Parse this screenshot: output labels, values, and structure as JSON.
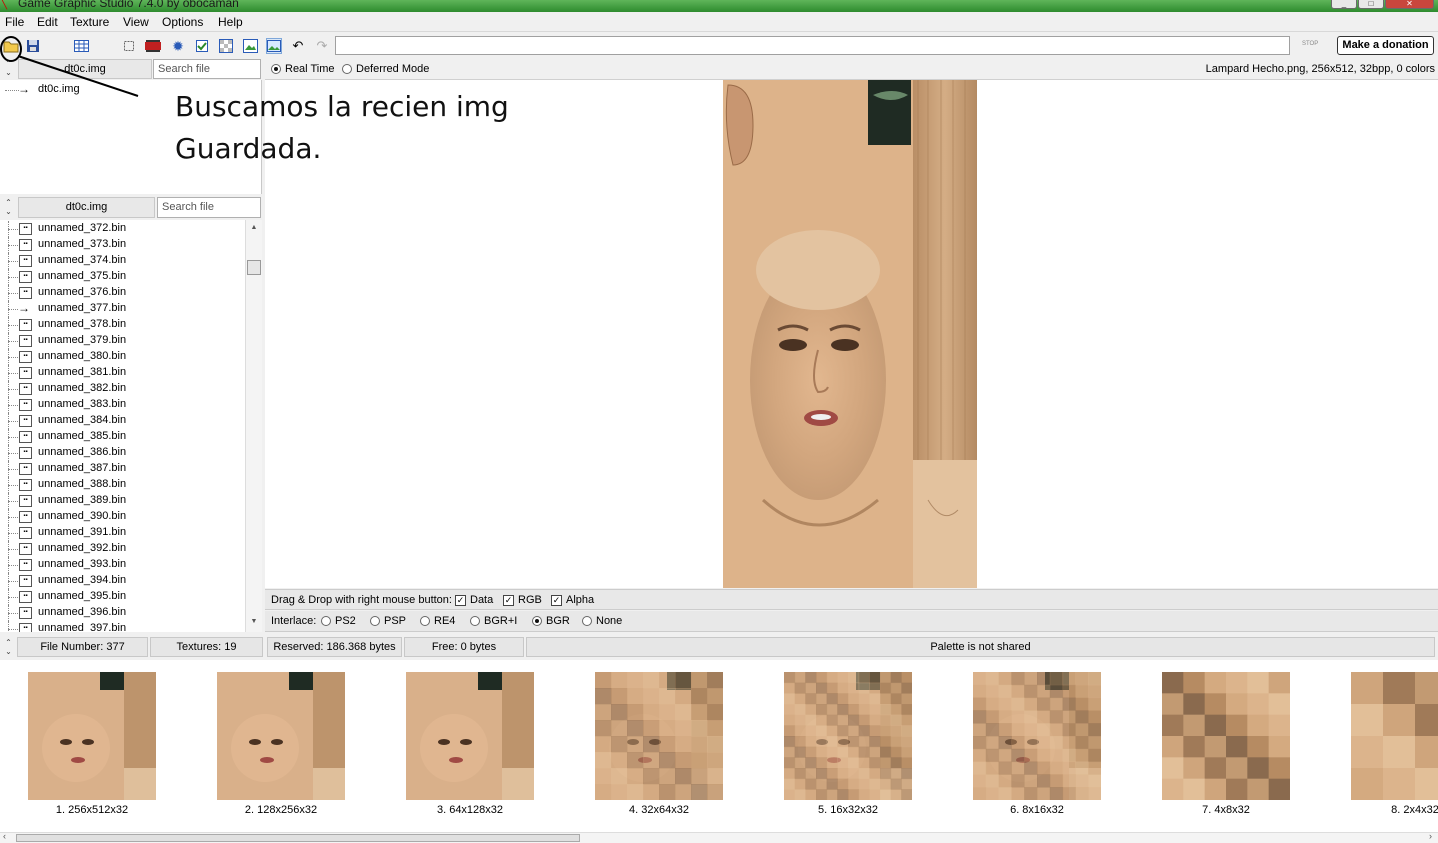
{
  "window": {
    "title": "Game Graphic Studio 7.4.0 by obocaman",
    "buttons": [
      "_",
      "□",
      "✕"
    ]
  },
  "menu": [
    "File",
    "Edit",
    "Texture",
    "View",
    "Options",
    "Help"
  ],
  "toolbar": {
    "stop_label": "STOP",
    "donate_label": "Make a donation",
    "icons": [
      "open-folder-icon",
      "save-icon",
      "grid-icon",
      "blank-icon",
      "film-icon",
      "gear-icon",
      "check-icon",
      "transparency-icon",
      "fit-image-icon",
      "image-icon",
      "undo-icon",
      "redo-icon"
    ]
  },
  "top_panel": {
    "header": "dt0c.img",
    "search_placeholder": "Search file",
    "tree_item": "dt0c.img"
  },
  "file_panel": {
    "header": "dt0c.img",
    "search_placeholder": "Search file",
    "files": [
      "unnamed_372.bin",
      "unnamed_373.bin",
      "unnamed_374.bin",
      "unnamed_375.bin",
      "unnamed_376.bin",
      "unnamed_377.bin",
      "unnamed_378.bin",
      "unnamed_379.bin",
      "unnamed_380.bin",
      "unnamed_381.bin",
      "unnamed_382.bin",
      "unnamed_383.bin",
      "unnamed_384.bin",
      "unnamed_385.bin",
      "unnamed_386.bin",
      "unnamed_387.bin",
      "unnamed_388.bin",
      "unnamed_389.bin",
      "unnamed_390.bin",
      "unnamed_391.bin",
      "unnamed_392.bin",
      "unnamed_393.bin",
      "unnamed_394.bin",
      "unnamed_395.bin",
      "unnamed_396.bin",
      "unnamed_397.bin"
    ],
    "selected_file": "unnamed_377.bin"
  },
  "mode": {
    "real_time": "Real Time",
    "deferred": "Deferred Mode",
    "selected": "Real Time",
    "image_info": "Lampard Hecho.png, 256x512, 32bpp, 0 colors"
  },
  "drag_drop": {
    "label": "Drag & Drop with right mouse button:",
    "data": "Data",
    "rgb": "RGB",
    "alpha": "Alpha",
    "data_checked": true,
    "rgb_checked": true,
    "alpha_checked": true
  },
  "interlace": {
    "label": "Interlace:",
    "options": [
      "PS2",
      "PSP",
      "RE4",
      "BGR+I",
      "BGR",
      "None"
    ],
    "selected": "BGR"
  },
  "status": {
    "file_number": "File Number: 377",
    "textures": "Textures: 19",
    "reserved": "Reserved: 186.368 bytes",
    "free": "Free: 0 bytes",
    "palette": "Palette is not shared"
  },
  "mipmaps": [
    "1. 256x512x32",
    "2. 128x256x32",
    "3. 64x128x32",
    "4. 32x64x32",
    "5. 16x32x32",
    "6. 8x16x32",
    "7. 4x8x32",
    "8. 2x4x32"
  ],
  "annotation": {
    "line1": "Buscamos la recien img",
    "line2": "Guardada."
  }
}
